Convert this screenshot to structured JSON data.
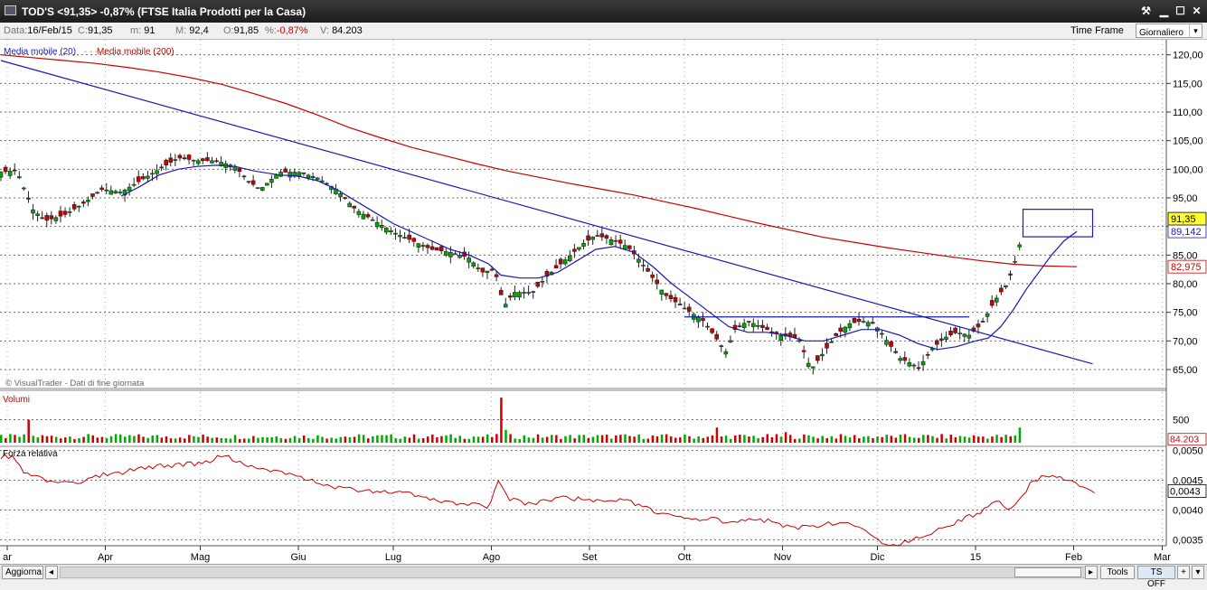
{
  "window": {
    "title": "TOD'S <91,35> -0,87%  (FTSE Italia Prodotti per la Casa)",
    "tool_icon": "wrench-icon",
    "min_icon": "minimize-icon",
    "max_icon": "maximize-icon",
    "close_icon": "close-icon"
  },
  "info": {
    "data_label": "Data:",
    "data_value": "16/Feb/15",
    "c_label": "C:",
    "c_value": "91,35",
    "m_label": "m:",
    "m_value": "91",
    "M_label": "M:",
    "M_value": "92,4",
    "o_label": "O:",
    "o_value": "91,85",
    "pct_label": "%:",
    "pct_value": "-0,87%",
    "v_label": "V:",
    "v_value": "84.203",
    "timeframe_label": "Time Frame",
    "timeframe_value": "Giornaliero"
  },
  "bottom": {
    "update_button": "Aggiorna",
    "tools_button": "Tools",
    "tsoff_button": "TS OFF",
    "plus_label": "+",
    "arrow_label": "▾"
  },
  "colors": {
    "up": "#00aa00",
    "down": "#cc0000",
    "ma20": "#1a1ab4",
    "ma200": "#cc0000",
    "rs": "#cc0000",
    "grid": "#6a6a6a",
    "last_price_bg": "#ffff33"
  },
  "chart_data": [
    {
      "type": "candlestick",
      "title": "TOD'S",
      "legend": [
        {
          "name": "Media mobile (20)",
          "color": "#1a1ab4"
        },
        {
          "name": "Media mobile (200)",
          "color": "#cc0000"
        }
      ],
      "watermark": "© VisualTrader - Dati di fine giornata",
      "ylim": [
        62,
        122
      ],
      "yticks": [
        "120,00",
        "115,00",
        "110,00",
        "105,00",
        "100,00",
        "95,00",
        "90,00",
        "85,00",
        "80,00",
        "75,00",
        "70,00",
        "65,00"
      ],
      "ytick_values": [
        120,
        115,
        110,
        105,
        100,
        95,
        90,
        85,
        80,
        75,
        70,
        65
      ],
      "xticks": [
        "ar",
        "Apr",
        "Mag",
        "Giu",
        "Lug",
        "Ago",
        "Set",
        "Ott",
        "Nov",
        "Dic",
        "15",
        "Feb",
        "Mar"
      ],
      "xtick_days": [
        2,
        33,
        63,
        94,
        124,
        155,
        186,
        216,
        247,
        277,
        308,
        339,
        367
      ],
      "last_day": 323,
      "price_path": [
        [
          0,
          99.5
        ],
        [
          5,
          99.8
        ],
        [
          10,
          93
        ],
        [
          14,
          91
        ],
        [
          20,
          92
        ],
        [
          26,
          94
        ],
        [
          32,
          96.5
        ],
        [
          38,
          96
        ],
        [
          44,
          98
        ],
        [
          50,
          100
        ],
        [
          56,
          102
        ],
        [
          62,
          101.5
        ],
        [
          68,
          101.5
        ],
        [
          74,
          100.5
        ],
        [
          78,
          98
        ],
        [
          82,
          96.5
        ],
        [
          88,
          99.5
        ],
        [
          94,
          99.5
        ],
        [
          100,
          98.5
        ],
        [
          106,
          96.5
        ],
        [
          112,
          93
        ],
        [
          118,
          91
        ],
        [
          124,
          89
        ],
        [
          130,
          87.5
        ],
        [
          136,
          86
        ],
        [
          142,
          85.5
        ],
        [
          148,
          84.5
        ],
        [
          152,
          82
        ],
        [
          156,
          82.5
        ],
        [
          159,
          76
        ],
        [
          162,
          78.5
        ],
        [
          168,
          78.5
        ],
        [
          172,
          81
        ],
        [
          178,
          84
        ],
        [
          184,
          87
        ],
        [
          188,
          88.5
        ],
        [
          194,
          87.5
        ],
        [
          198,
          86.5
        ],
        [
          202,
          84
        ],
        [
          206,
          81
        ],
        [
          210,
          78
        ],
        [
          214,
          76.5
        ],
        [
          218,
          75
        ],
        [
          222,
          73.5
        ],
        [
          226,
          70.5
        ],
        [
          229,
          68
        ],
        [
          232,
          72
        ],
        [
          236,
          73.5
        ],
        [
          240,
          72.5
        ],
        [
          246,
          71
        ],
        [
          252,
          70.5
        ],
        [
          256,
          65
        ],
        [
          260,
          68
        ],
        [
          264,
          71
        ],
        [
          268,
          73
        ],
        [
          272,
          73.5
        ],
        [
          276,
          73
        ],
        [
          280,
          70
        ],
        [
          284,
          67
        ],
        [
          288,
          66
        ],
        [
          290,
          65.2
        ],
        [
          294,
          68.5
        ],
        [
          298,
          70.5
        ],
        [
          302,
          71.5
        ],
        [
          306,
          71
        ],
        [
          310,
          73
        ],
        [
          314,
          77
        ],
        [
          318,
          80
        ],
        [
          320,
          83
        ],
        [
          322,
          87
        ],
        [
          324,
          90.5
        ],
        [
          328,
          91
        ],
        [
          332,
          91.5
        ],
        [
          336,
          91.8
        ],
        [
          340,
          91
        ],
        [
          343,
          91.5
        ],
        [
          346,
          91.35
        ]
      ],
      "ma20_path": [
        [
          38,
          95.3
        ],
        [
          44,
          97
        ],
        [
          50,
          99
        ],
        [
          56,
          100
        ],
        [
          62,
          100.5
        ],
        [
          68,
          100.7
        ],
        [
          74,
          100.5
        ],
        [
          80,
          99.7
        ],
        [
          88,
          99
        ],
        [
          94,
          98.8
        ],
        [
          100,
          98
        ],
        [
          106,
          96.5
        ],
        [
          112,
          94.5
        ],
        [
          118,
          92.5
        ],
        [
          124,
          90.5
        ],
        [
          130,
          89
        ],
        [
          136,
          87.5
        ],
        [
          142,
          86
        ],
        [
          148,
          85
        ],
        [
          154,
          83.5
        ],
        [
          158,
          81.5
        ],
        [
          164,
          81
        ],
        [
          170,
          81
        ],
        [
          176,
          82
        ],
        [
          182,
          84
        ],
        [
          188,
          86
        ],
        [
          194,
          86.5
        ],
        [
          200,
          85.5
        ],
        [
          206,
          83
        ],
        [
          212,
          80
        ],
        [
          218,
          77.5
        ],
        [
          224,
          75
        ],
        [
          230,
          72.5
        ],
        [
          236,
          71.5
        ],
        [
          242,
          71.5
        ],
        [
          248,
          71
        ],
        [
          254,
          70
        ],
        [
          260,
          70
        ],
        [
          266,
          71
        ],
        [
          272,
          72
        ],
        [
          278,
          72
        ],
        [
          284,
          71
        ],
        [
          290,
          69.5
        ],
        [
          296,
          68.5
        ],
        [
          302,
          69
        ],
        [
          308,
          70
        ],
        [
          312,
          70.5
        ],
        [
          316,
          72.5
        ],
        [
          320,
          75.5
        ],
        [
          324,
          79
        ],
        [
          328,
          82
        ],
        [
          332,
          85
        ],
        [
          336,
          87.5
        ],
        [
          340,
          89.14
        ]
      ],
      "ma200_path": [
        [
          0,
          120
        ],
        [
          10,
          119.5
        ],
        [
          20,
          119
        ],
        [
          30,
          118.5
        ],
        [
          40,
          117.8
        ],
        [
          50,
          117
        ],
        [
          60,
          116
        ],
        [
          70,
          114.8
        ],
        [
          80,
          113.2
        ],
        [
          90,
          111.5
        ],
        [
          100,
          109.5
        ],
        [
          110,
          107.3
        ],
        [
          120,
          105.5
        ],
        [
          130,
          103.8
        ],
        [
          140,
          102.4
        ],
        [
          150,
          101
        ],
        [
          160,
          99.7
        ],
        [
          170,
          98.6
        ],
        [
          180,
          97.5
        ],
        [
          190,
          96.5
        ],
        [
          200,
          95.5
        ],
        [
          210,
          94.3
        ],
        [
          220,
          93.1
        ],
        [
          230,
          91.8
        ],
        [
          240,
          90.5
        ],
        [
          250,
          89.3
        ],
        [
          260,
          88.1
        ],
        [
          270,
          87.2
        ],
        [
          280,
          86.3
        ],
        [
          290,
          85.5
        ],
        [
          300,
          84.7
        ],
        [
          310,
          84
        ],
        [
          320,
          83.4
        ],
        [
          330,
          83.1
        ],
        [
          340,
          82.975
        ]
      ],
      "trendline": {
        "from": [
          0,
          119
        ],
        "to": [
          345,
          66
        ]
      },
      "hline": {
        "from_day": 216,
        "to_day": 306,
        "value": 74.2
      },
      "box": {
        "from_day": 323,
        "to_day": 345,
        "low": 88.2,
        "high": 93
      },
      "price_tag": "91,35",
      "ma20_tag": "89,142",
      "ma200_tag": "82,975"
    },
    {
      "type": "bar",
      "title": "Volumi",
      "yticks": [
        "500"
      ],
      "ytick_values": [
        500
      ],
      "ylim": [
        0,
        1100
      ],
      "last_tag": "84.203",
      "base": 80,
      "spikes": [
        [
          8,
          600
        ],
        [
          9,
          500
        ],
        [
          40,
          260
        ],
        [
          158,
          980
        ],
        [
          159,
          280
        ],
        [
          247,
          680
        ],
        [
          248,
          230
        ],
        [
          226,
          330
        ],
        [
          322,
          330
        ],
        [
          323,
          420
        ],
        [
          324,
          800
        ],
        [
          325,
          450
        ],
        [
          326,
          300
        ],
        [
          328,
          380
        ],
        [
          314,
          300
        ],
        [
          317,
          270
        ]
      ]
    },
    {
      "type": "line",
      "title": "Forza relativa",
      "ylim": [
        0.0034,
        0.0051
      ],
      "yticks": [
        "0,0050",
        "0,0045",
        "0,0040",
        "0,0035"
      ],
      "ytick_values": [
        0.005,
        0.0045,
        0.004,
        0.0035
      ],
      "rs_tag": "0,0043",
      "rs_path": [
        [
          0,
          0.0049
        ],
        [
          4,
          0.00488
        ],
        [
          8,
          0.0046
        ],
        [
          14,
          0.0045
        ],
        [
          20,
          0.00445
        ],
        [
          26,
          0.00448
        ],
        [
          32,
          0.0046
        ],
        [
          38,
          0.00462
        ],
        [
          44,
          0.0047
        ],
        [
          50,
          0.00474
        ],
        [
          56,
          0.00475
        ],
        [
          62,
          0.00478
        ],
        [
          66,
          0.00482
        ],
        [
          70,
          0.00493
        ],
        [
          74,
          0.00482
        ],
        [
          80,
          0.0047
        ],
        [
          86,
          0.00465
        ],
        [
          92,
          0.00458
        ],
        [
          98,
          0.0045
        ],
        [
          104,
          0.0044
        ],
        [
          110,
          0.00436
        ],
        [
          116,
          0.00432
        ],
        [
          122,
          0.0043
        ],
        [
          128,
          0.00428
        ],
        [
          134,
          0.0042
        ],
        [
          140,
          0.00415
        ],
        [
          146,
          0.0041
        ],
        [
          150,
          0.0041
        ],
        [
          154,
          0.00402
        ],
        [
          157,
          0.0045
        ],
        [
          160,
          0.0042
        ],
        [
          166,
          0.00412
        ],
        [
          172,
          0.00414
        ],
        [
          178,
          0.0042
        ],
        [
          184,
          0.00418
        ],
        [
          190,
          0.00415
        ],
        [
          196,
          0.00418
        ],
        [
          202,
          0.00408
        ],
        [
          208,
          0.00395
        ],
        [
          214,
          0.00388
        ],
        [
          220,
          0.00382
        ],
        [
          226,
          0.00385
        ],
        [
          230,
          0.00377
        ],
        [
          236,
          0.00384
        ],
        [
          242,
          0.00382
        ],
        [
          248,
          0.00374
        ],
        [
          252,
          0.0037
        ],
        [
          256,
          0.00372
        ],
        [
          262,
          0.00378
        ],
        [
          268,
          0.00375
        ],
        [
          274,
          0.00365
        ],
        [
          278,
          0.00345
        ],
        [
          282,
          0.0034
        ],
        [
          286,
          0.00347
        ],
        [
          292,
          0.00358
        ],
        [
          298,
          0.0037
        ],
        [
          304,
          0.00385
        ],
        [
          310,
          0.00398
        ],
        [
          314,
          0.00418
        ],
        [
          318,
          0.004
        ],
        [
          322,
          0.00418
        ],
        [
          326,
          0.00448
        ],
        [
          330,
          0.00458
        ],
        [
          334,
          0.00455
        ],
        [
          338,
          0.0045
        ],
        [
          342,
          0.00438
        ],
        [
          346,
          0.00432
        ]
      ]
    }
  ]
}
